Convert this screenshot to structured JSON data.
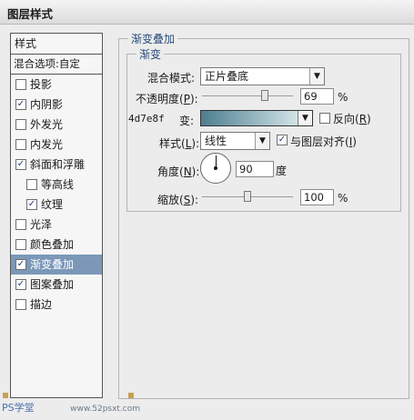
{
  "window": {
    "title": "图层样式"
  },
  "sidebar": {
    "header": "样式",
    "blend_options": "混合选项:自定",
    "items": [
      {
        "label": "投影",
        "checked": false,
        "sub": false,
        "selected": false
      },
      {
        "label": "内阴影",
        "checked": true,
        "sub": false,
        "selected": false
      },
      {
        "label": "外发光",
        "checked": false,
        "sub": false,
        "selected": false
      },
      {
        "label": "内发光",
        "checked": false,
        "sub": false,
        "selected": false
      },
      {
        "label": "斜面和浮雕",
        "checked": true,
        "sub": false,
        "selected": false
      },
      {
        "label": "等高线",
        "checked": false,
        "sub": true,
        "selected": false
      },
      {
        "label": "纹理",
        "checked": true,
        "sub": true,
        "selected": false
      },
      {
        "label": "光泽",
        "checked": false,
        "sub": false,
        "selected": false
      },
      {
        "label": "颜色叠加",
        "checked": false,
        "sub": false,
        "selected": false
      },
      {
        "label": "渐变叠加",
        "checked": true,
        "sub": false,
        "selected": true
      },
      {
        "label": "图案叠加",
        "checked": true,
        "sub": false,
        "selected": false
      },
      {
        "label": "描边",
        "checked": false,
        "sub": false,
        "selected": false
      }
    ]
  },
  "panel": {
    "outer_title": "渐变叠加",
    "inner_title": "渐变",
    "blend_mode": {
      "label": "混合模式:",
      "value": "正片叠底"
    },
    "opacity": {
      "label_pre": "不透明度(",
      "key": "P",
      "label_post": "):",
      "value": "69",
      "unit": "%",
      "level": 0.69
    },
    "gradient": {
      "hex_label": "4d7e8f",
      "label": "变:",
      "start_color": "#4d7e8f",
      "end_color": "#e6f2f4"
    },
    "reverse": {
      "label_pre": "反向(",
      "key": "R",
      "label_post": ")",
      "checked": false
    },
    "style": {
      "label_pre": "样式(",
      "key": "L",
      "label_post": "):",
      "value": "线性"
    },
    "align": {
      "label_pre": "与图层对齐(",
      "key": "I",
      "label_post": ")",
      "checked": true
    },
    "angle": {
      "label_pre": "角度(",
      "key": "N",
      "label_post": "):",
      "value": "90",
      "unit": "度"
    },
    "scale": {
      "label_pre": "缩放(",
      "key": "S",
      "label_post": "):",
      "value": "100",
      "unit": "%",
      "level": 0.5
    }
  },
  "watermark": {
    "text": "PS学堂",
    "site": "www.52psxt.com"
  },
  "colors": {
    "selected_bg": "#7c98b8",
    "group_title": "#2a4d7a",
    "checkmark": "#1f3f7a"
  }
}
